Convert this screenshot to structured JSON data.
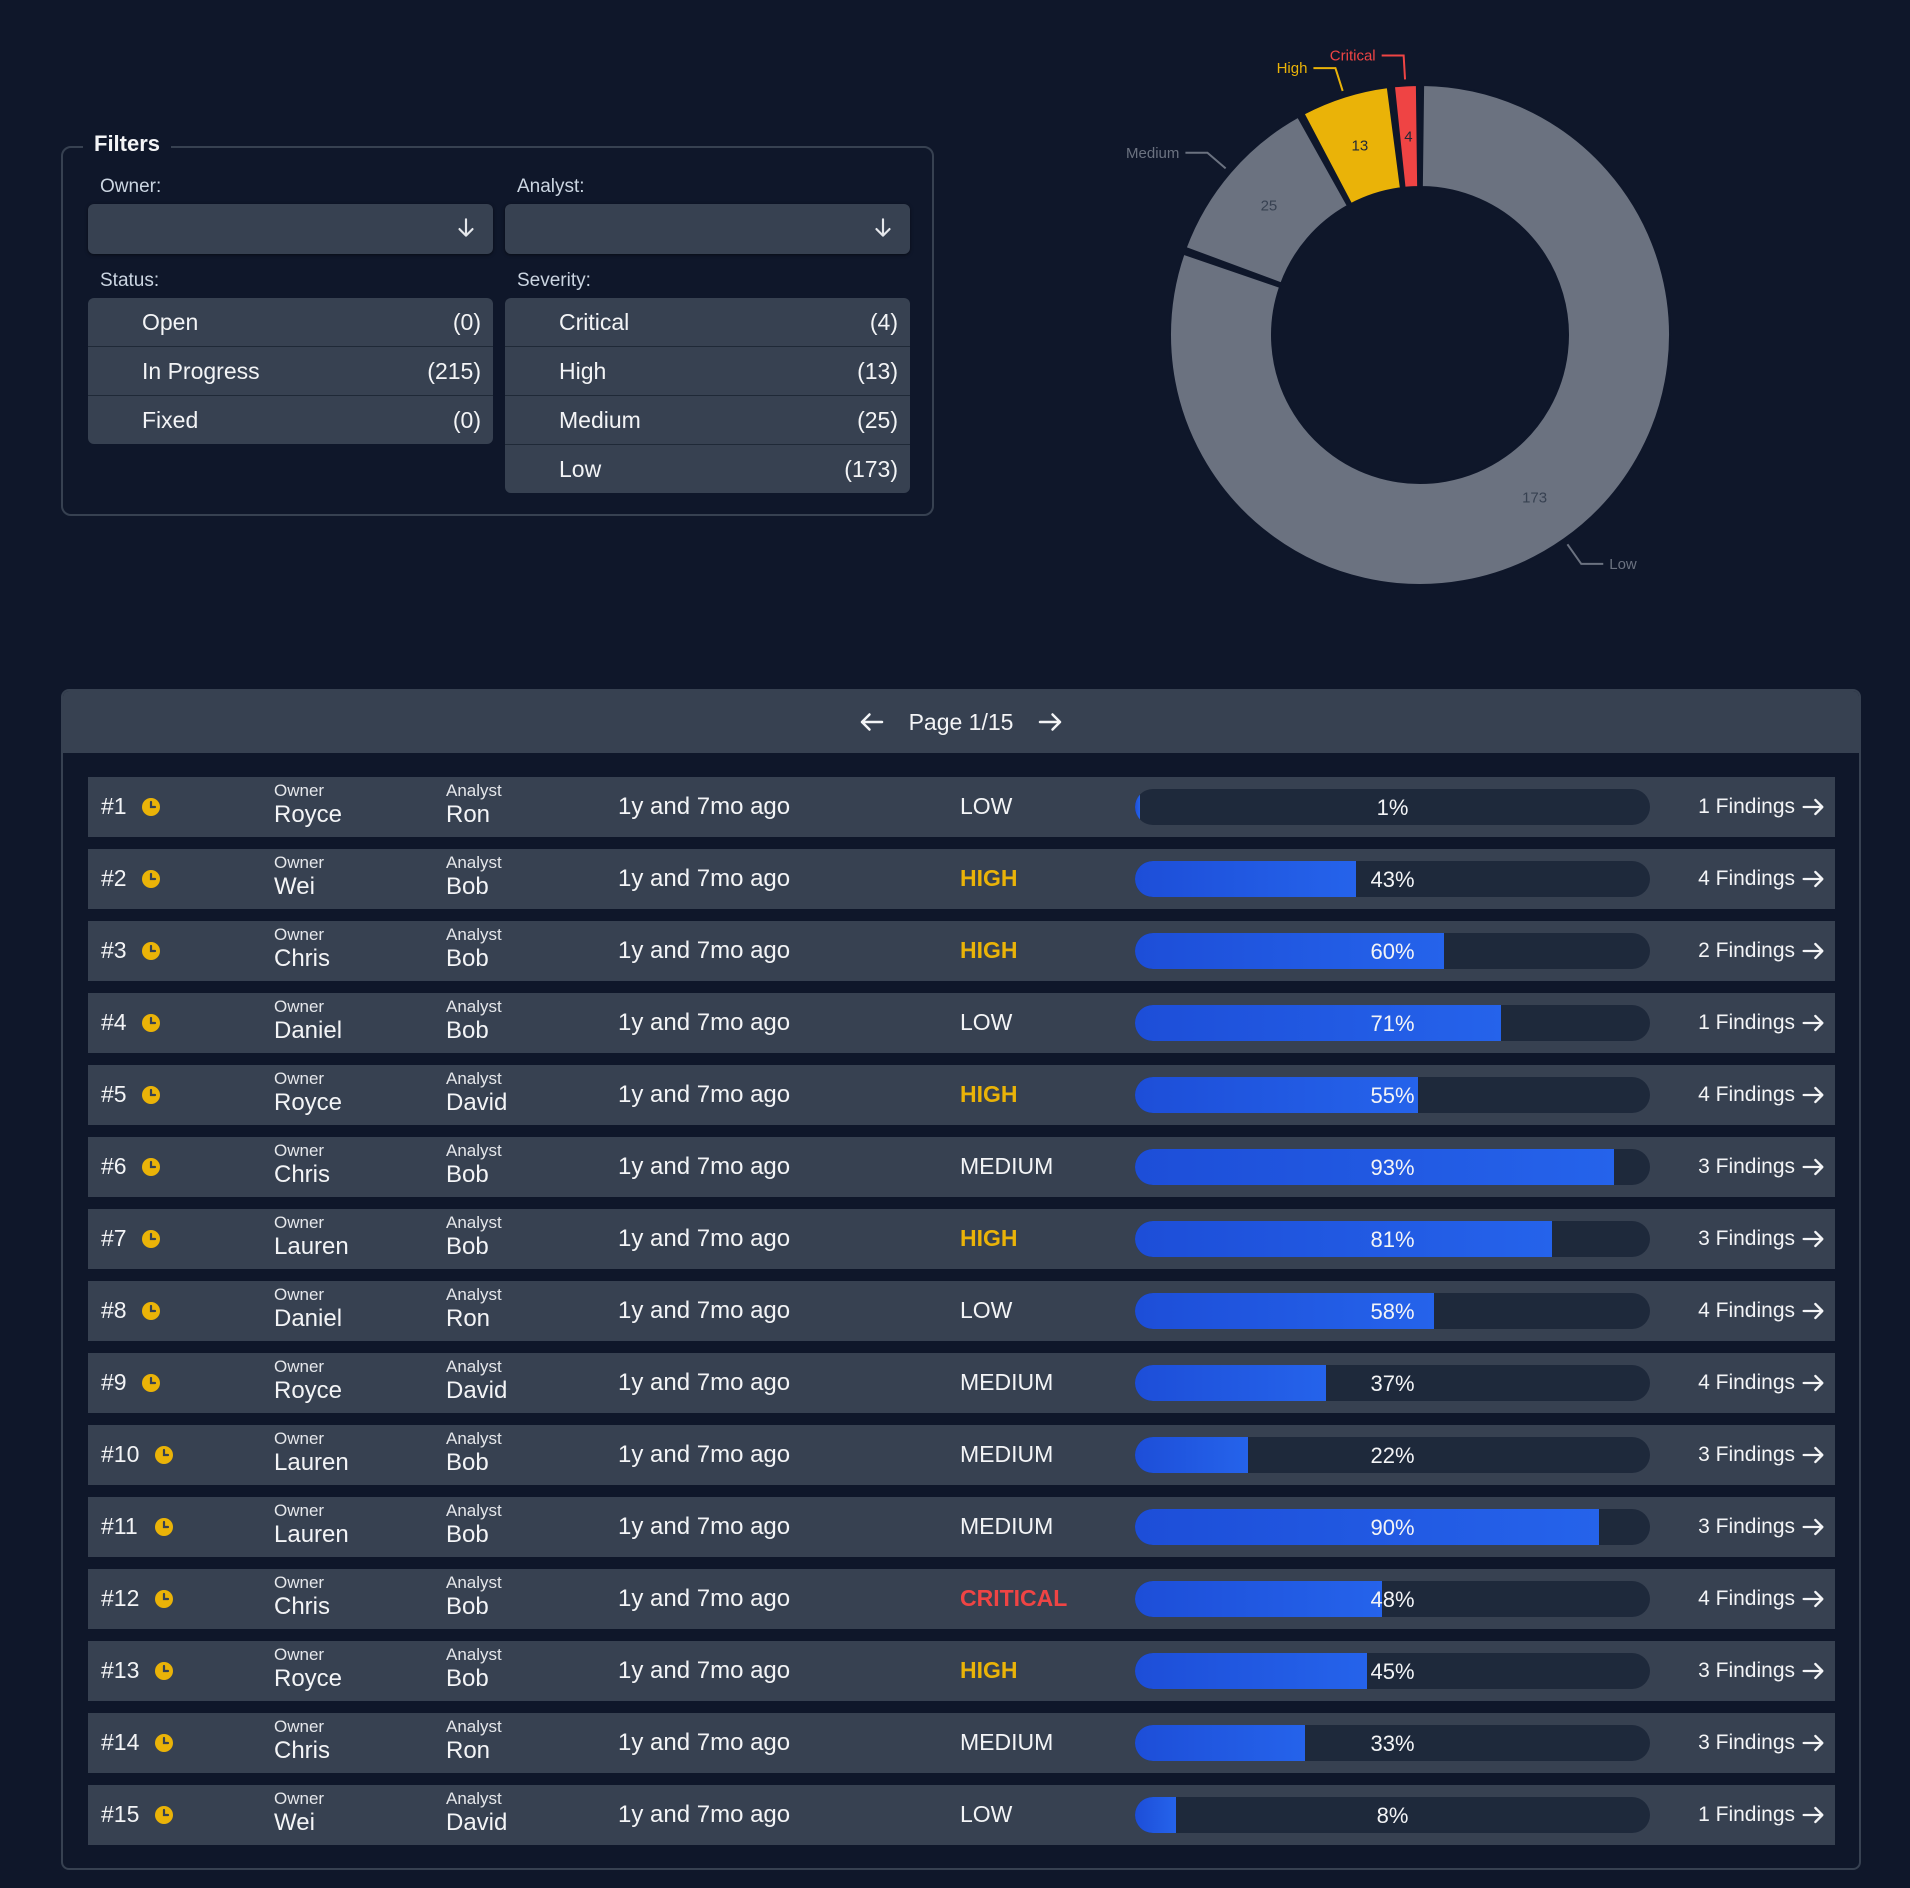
{
  "colors": {
    "background": "#0f172a",
    "panel": "#374151",
    "critical": "#ef4444",
    "high": "#eab308",
    "medium": "#6b7280",
    "low": "#6b7280",
    "bar": "#2563eb",
    "clock": "#eab308"
  },
  "filters": {
    "title": "Filters",
    "owner_label": "Owner:",
    "owner_value": "",
    "analyst_label": "Analyst:",
    "analyst_value": "",
    "status_label": "Status:",
    "status_options": [
      {
        "label": "Open",
        "count": "(0)"
      },
      {
        "label": "In Progress",
        "count": "(215)"
      },
      {
        "label": "Fixed",
        "count": "(0)"
      }
    ],
    "severity_label": "Severity:",
    "severity_options": [
      {
        "label": "Critical",
        "count": "(4)"
      },
      {
        "label": "High",
        "count": "(13)"
      },
      {
        "label": "Medium",
        "count": "(25)"
      },
      {
        "label": "Low",
        "count": "(173)"
      }
    ]
  },
  "chart_data": {
    "type": "pie",
    "variant": "donut",
    "slices": [
      {
        "label": "Low",
        "value": 173,
        "color": "#6b7280"
      },
      {
        "label": "Medium",
        "value": 25,
        "color": "#6b7280"
      },
      {
        "label": "High",
        "value": 13,
        "color": "#eab308"
      },
      {
        "label": "Critical",
        "value": 4,
        "color": "#ef4444"
      }
    ]
  },
  "pager": {
    "label": "Page 1/15"
  },
  "table": {
    "owner_label": "Owner",
    "analyst_label": "Analyst",
    "rows": [
      {
        "id": "#1",
        "owner": "Royce",
        "analyst": "Ron",
        "time": "1y and 7mo ago",
        "severity": "LOW",
        "progress": 1,
        "progress_label": "1%",
        "findings": "1 Findings"
      },
      {
        "id": "#2",
        "owner": "Wei",
        "analyst": "Bob",
        "time": "1y and 7mo ago",
        "severity": "HIGH",
        "progress": 43,
        "progress_label": "43%",
        "findings": "4 Findings"
      },
      {
        "id": "#3",
        "owner": "Chris",
        "analyst": "Bob",
        "time": "1y and 7mo ago",
        "severity": "HIGH",
        "progress": 60,
        "progress_label": "60%",
        "findings": "2 Findings"
      },
      {
        "id": "#4",
        "owner": "Daniel",
        "analyst": "Bob",
        "time": "1y and 7mo ago",
        "severity": "LOW",
        "progress": 71,
        "progress_label": "71%",
        "findings": "1 Findings"
      },
      {
        "id": "#5",
        "owner": "Royce",
        "analyst": "David",
        "time": "1y and 7mo ago",
        "severity": "HIGH",
        "progress": 55,
        "progress_label": "55%",
        "findings": "4 Findings"
      },
      {
        "id": "#6",
        "owner": "Chris",
        "analyst": "Bob",
        "time": "1y and 7mo ago",
        "severity": "MEDIUM",
        "progress": 93,
        "progress_label": "93%",
        "findings": "3 Findings"
      },
      {
        "id": "#7",
        "owner": "Lauren",
        "analyst": "Bob",
        "time": "1y and 7mo ago",
        "severity": "HIGH",
        "progress": 81,
        "progress_label": "81%",
        "findings": "3 Findings"
      },
      {
        "id": "#8",
        "owner": "Daniel",
        "analyst": "Ron",
        "time": "1y and 7mo ago",
        "severity": "LOW",
        "progress": 58,
        "progress_label": "58%",
        "findings": "4 Findings"
      },
      {
        "id": "#9",
        "owner": "Royce",
        "analyst": "David",
        "time": "1y and 7mo ago",
        "severity": "MEDIUM",
        "progress": 37,
        "progress_label": "37%",
        "findings": "4 Findings"
      },
      {
        "id": "#10",
        "owner": "Lauren",
        "analyst": "Bob",
        "time": "1y and 7mo ago",
        "severity": "MEDIUM",
        "progress": 22,
        "progress_label": "22%",
        "findings": "3 Findings"
      },
      {
        "id": "#11",
        "owner": "Lauren",
        "analyst": "Bob",
        "time": "1y and 7mo ago",
        "severity": "MEDIUM",
        "progress": 90,
        "progress_label": "90%",
        "findings": "3 Findings"
      },
      {
        "id": "#12",
        "owner": "Chris",
        "analyst": "Bob",
        "time": "1y and 7mo ago",
        "severity": "CRITICAL",
        "progress": 48,
        "progress_label": "48%",
        "findings": "4 Findings"
      },
      {
        "id": "#13",
        "owner": "Royce",
        "analyst": "Bob",
        "time": "1y and 7mo ago",
        "severity": "HIGH",
        "progress": 45,
        "progress_label": "45%",
        "findings": "3 Findings"
      },
      {
        "id": "#14",
        "owner": "Chris",
        "analyst": "Ron",
        "time": "1y and 7mo ago",
        "severity": "MEDIUM",
        "progress": 33,
        "progress_label": "33%",
        "findings": "3 Findings"
      },
      {
        "id": "#15",
        "owner": "Wei",
        "analyst": "David",
        "time": "1y and 7mo ago",
        "severity": "LOW",
        "progress": 8,
        "progress_label": "8%",
        "findings": "1 Findings"
      }
    ]
  }
}
